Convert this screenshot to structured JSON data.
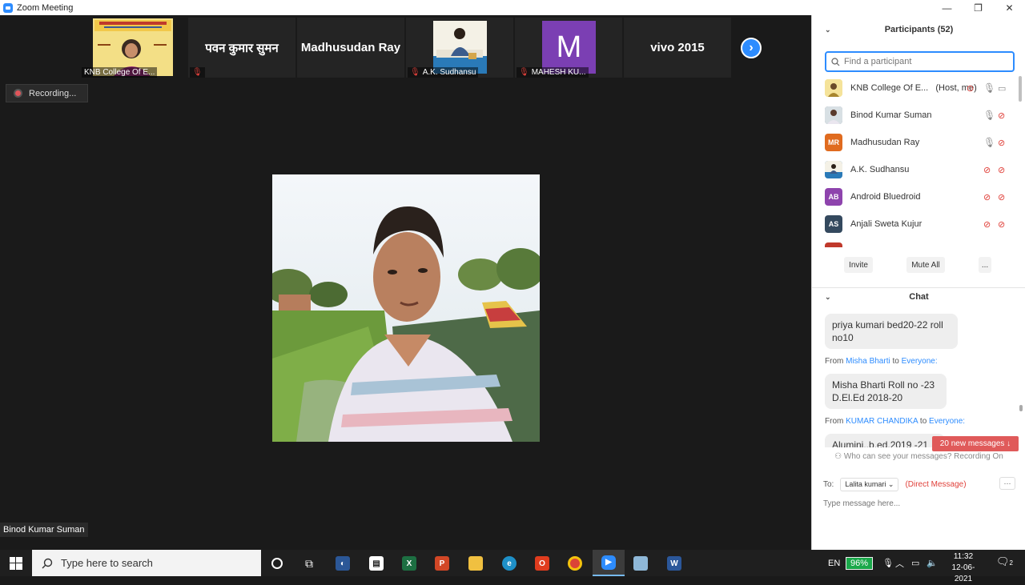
{
  "window": {
    "title": "Zoom Meeting",
    "controls": [
      "—",
      "❐",
      "✕"
    ]
  },
  "strip": {
    "tiles": [
      {
        "name": "",
        "label": "KNB College Of E..."
      },
      {
        "name": "पवन कुमार सुमन",
        "label": ""
      },
      {
        "name": "Madhusudan Ray",
        "label": ""
      },
      {
        "name": "",
        "label": "A.K. Sudhansu"
      },
      {
        "name": "M",
        "label": "MAHESH KU..."
      },
      {
        "name": "vivo 2015",
        "label": ""
      }
    ],
    "next_icon": "chevron-right-icon"
  },
  "recording": {
    "label": "Recording..."
  },
  "speaker": {
    "name": "Binod Kumar Suman"
  },
  "participants": {
    "header": "Participants (52)",
    "search_placeholder": "Find a participant",
    "list": [
      {
        "name": "KNB College Of E...",
        "tag": "(Host, me)",
        "initials": "",
        "color": "#c9a13a",
        "mic": "on",
        "video": "on"
      },
      {
        "name": "Binod Kumar Suman",
        "tag": "",
        "initials": "",
        "color": "#6b7b8a",
        "mic": "on",
        "video": "off"
      },
      {
        "name": "Madhusudan Ray",
        "tag": "",
        "initials": "MR",
        "color": "#e06b1f",
        "mic": "on",
        "video": "off"
      },
      {
        "name": "A.K. Sudhansu",
        "tag": "",
        "initials": "",
        "color": "#3a7fbf",
        "mic": "off",
        "video": "off"
      },
      {
        "name": "Android Bluedroid",
        "tag": "",
        "initials": "AB",
        "color": "#8e44ad",
        "mic": "off",
        "video": "off"
      },
      {
        "name": "Anjali Sweta Kujur",
        "tag": "",
        "initials": "AS",
        "color": "#34495e",
        "mic": "off",
        "video": "off"
      }
    ],
    "buttons": {
      "invite": "Invite",
      "mute_all": "Mute All",
      "more": "..."
    }
  },
  "chat": {
    "header": "Chat",
    "messages": [
      {
        "from": "",
        "to": "",
        "text": "priya kumari bed20-22 roll no10"
      },
      {
        "from": "Misha Bharti",
        "to": "Everyone:",
        "text": "Misha Bharti Roll no -23 D.El.Ed 2018-20"
      },
      {
        "from": "KUMAR CHANDIKA",
        "to": "Everyone:",
        "text": "Alumini..b.ed.2019 -21"
      }
    ],
    "from_word": "From",
    "to_word": "to",
    "new_messages": "20 new messages ↓",
    "notice": "Who can see your messages? Recording On",
    "to_label": "To:",
    "recipient": "Lalita kumari",
    "direct": "(Direct Message)",
    "more": "···",
    "input_placeholder": "Type message here..."
  },
  "taskbar": {
    "search_placeholder": "Type here to search",
    "lang": "EN",
    "battery": "96%",
    "time": "11:32",
    "date": "12-06-2021",
    "notifications": "2"
  },
  "colors": {
    "accent": "#2d8cff",
    "muted": "#e0403a",
    "bg": "#1a1a1a"
  }
}
